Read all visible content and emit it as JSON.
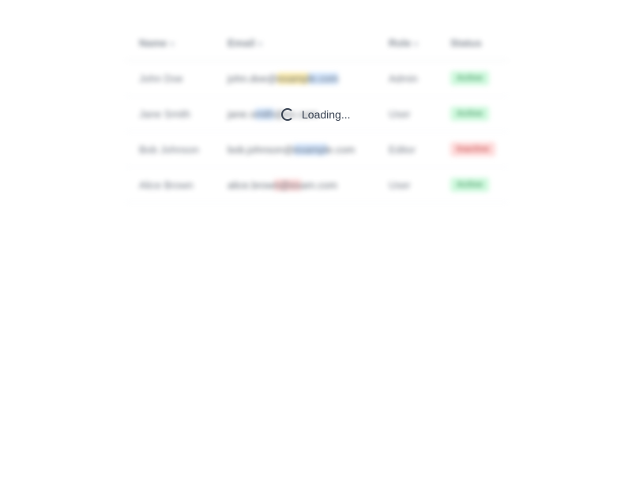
{
  "table": {
    "columns": [
      {
        "label": "Name",
        "sort": "▾"
      },
      {
        "label": "Email",
        "sort": "▾"
      },
      {
        "label": "Role",
        "sort": "▾"
      },
      {
        "label": "Status",
        "sort": ""
      }
    ],
    "rows": [
      {
        "name": "John Doe",
        "email_a": "john.doe@",
        "email_b": "examp",
        "email_c": "le.com",
        "role": "Admin",
        "status": "Active"
      },
      {
        "name": "Jane Smith",
        "email_a": "jane.s",
        "email_b": "mith",
        "email_c": "@ex.com",
        "role": "User",
        "status": "Active"
      },
      {
        "name": "Bob Johnson",
        "email_a": "bob.johnson@",
        "email_b": "exampl",
        "email_c": "e.com",
        "role": "Editor",
        "status": "Inactive"
      },
      {
        "name": "Alice Brown",
        "email_a": "alice.brow",
        "email_b": "n@ex",
        "email_c": "am.com",
        "role": "User",
        "status": "Active"
      }
    ]
  },
  "loading": {
    "text": "Loading...",
    "icon": "spinner-icon"
  },
  "colors": {
    "active": "#bbf7d0",
    "inactive": "#fecaca",
    "text": "#374151"
  }
}
